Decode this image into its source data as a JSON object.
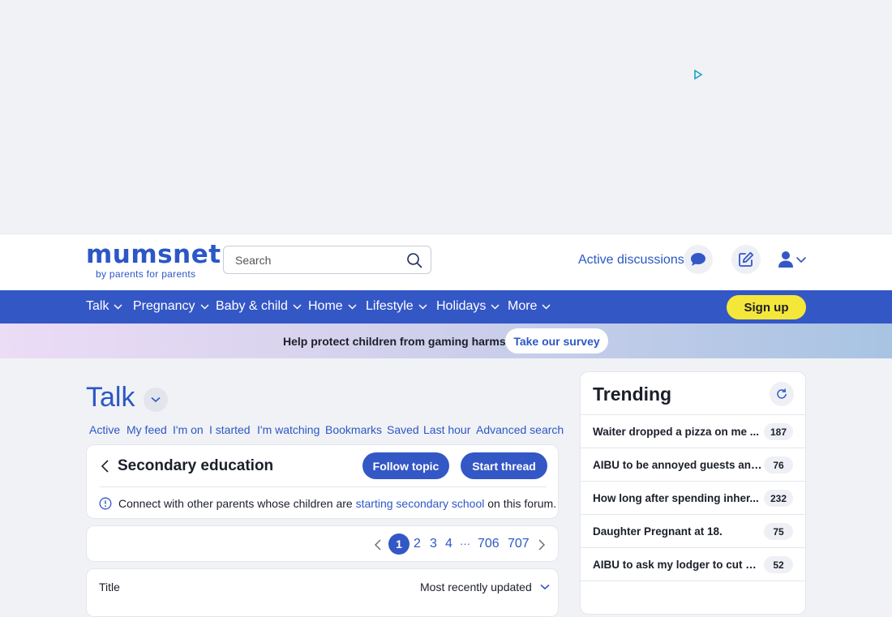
{
  "header": {
    "logo": "mumsnet",
    "tagline": "by parents for parents",
    "search_placeholder": "Search",
    "active_discussions": "Active discussions"
  },
  "nav": {
    "items": [
      "Talk",
      "Pregnancy",
      "Baby & child",
      "Home",
      "Lifestyle",
      "Holidays",
      "More"
    ],
    "signup": "Sign up"
  },
  "banner": {
    "text": "Help protect children from gaming harms.",
    "button": "Take our survey"
  },
  "talk": {
    "title": "Talk",
    "links": [
      "Active",
      "My feed",
      "I'm on",
      "I started",
      "I'm watching",
      "Bookmarks",
      "Saved",
      "Last hour",
      "Advanced search"
    ]
  },
  "topic": {
    "title": "Secondary education",
    "follow": "Follow topic",
    "start": "Start thread",
    "info_before": "Connect with other parents whose children are ",
    "info_link": "starting secondary school",
    "info_after": " on this forum."
  },
  "pager": {
    "current": "1",
    "pages": [
      "2",
      "3",
      "4",
      "···",
      "706",
      "707"
    ]
  },
  "list": {
    "title": "Title",
    "sort": "Most recently updated"
  },
  "trending": {
    "title": "Trending",
    "items": [
      {
        "text": "Waiter dropped a pizza on me ...",
        "count": "187"
      },
      {
        "text": "AIBU to be annoyed guests ann...",
        "count": "76"
      },
      {
        "text": "How long after spending inher...",
        "count": "232"
      },
      {
        "text": "Daughter Pregnant at 18.",
        "count": "75"
      },
      {
        "text": "AIBU to ask my lodger to cut do...",
        "count": "52"
      }
    ]
  }
}
